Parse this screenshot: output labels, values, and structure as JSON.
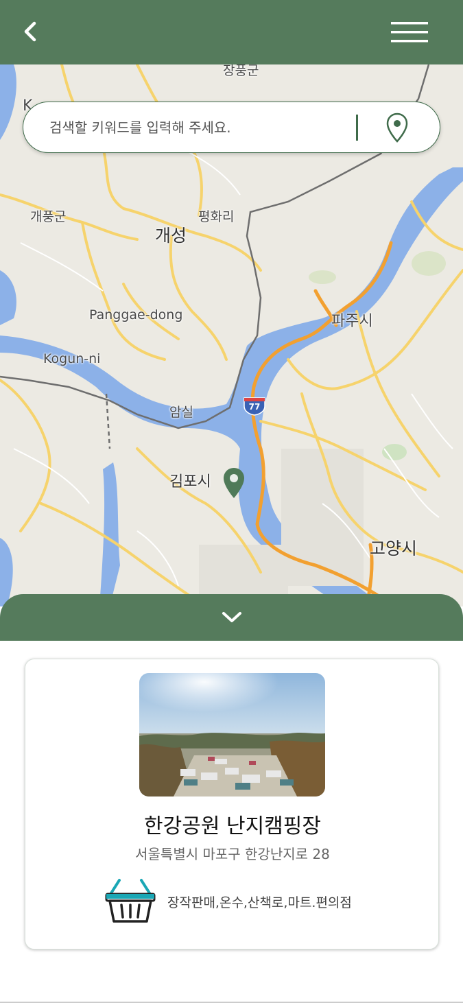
{
  "header": {
    "back_icon": "chevron-left-icon",
    "menu_icon": "hamburger-menu-icon",
    "color": "#557b5c"
  },
  "search": {
    "placeholder": "검색할 키워드를 입력해 주세요.",
    "location_icon": "location-pin-icon"
  },
  "map": {
    "labels": {
      "jangpunggun": "장풍군",
      "gaepunggun": "개풍군",
      "pyeonghwari": "평화리",
      "gaeseong": "개성",
      "panggae": "Panggae-dong",
      "kogun": "Kogun-ni",
      "paju": "파주시",
      "amsil": "암실",
      "gimpo": "김포시",
      "goyang": "고양시",
      "highway": "77",
      "edge_k": "K"
    }
  },
  "sheet": {
    "toggle_icon": "chevron-down-icon"
  },
  "place": {
    "title": "한강공원 난지캠핑장",
    "address": "서울특별시 마포구 한강난지로 28",
    "amenities": "장작판매,온수,산책로,마트.편의점",
    "amenity_icon": "shopping-basket-icon",
    "accent": "#1aa7b5"
  }
}
